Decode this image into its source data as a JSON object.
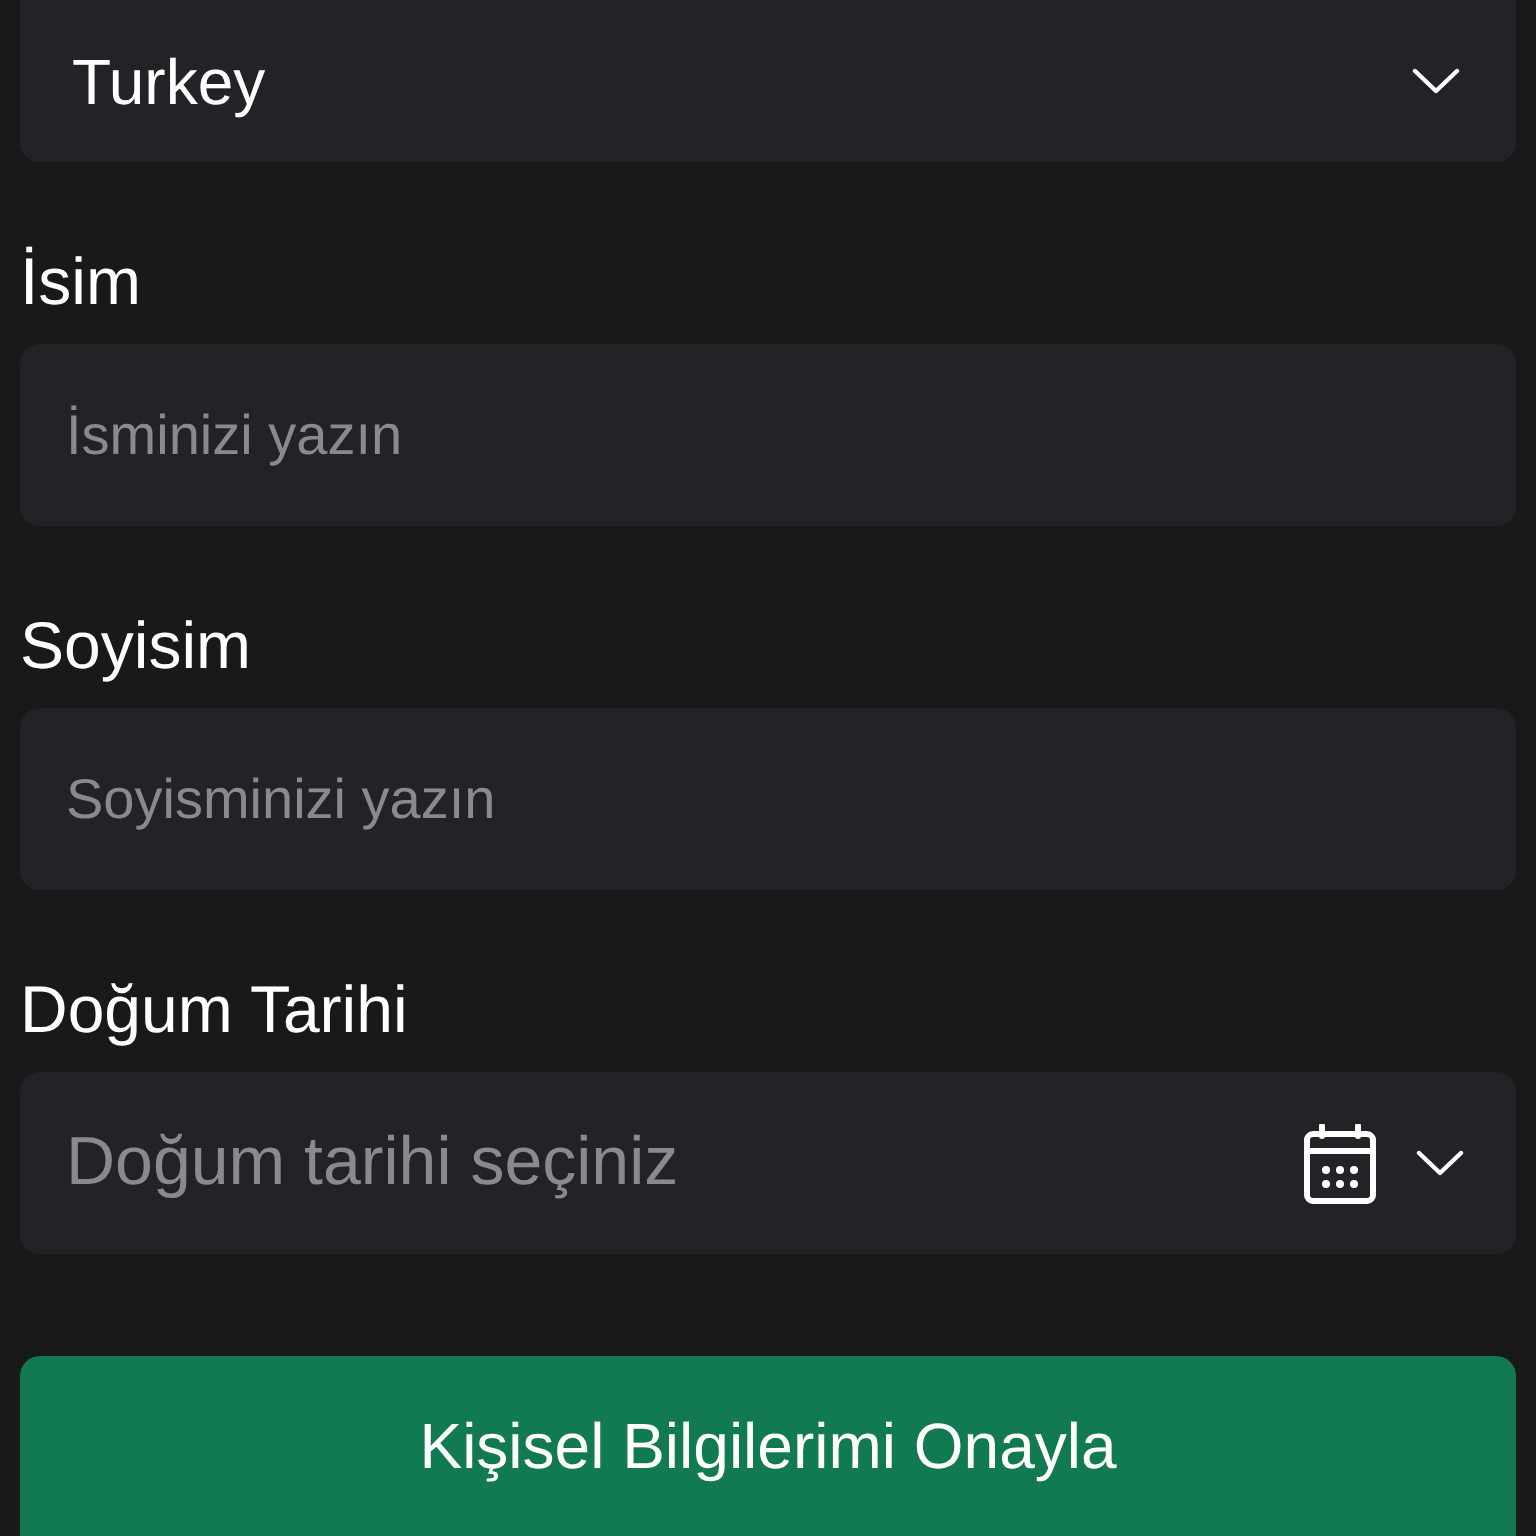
{
  "country_select": {
    "value": "Turkey"
  },
  "fields": [
    {
      "kind": "text",
      "label": "İsim",
      "placeholder": "İsminizi yazın"
    },
    {
      "kind": "text",
      "label": "Soyisim",
      "placeholder": "Soyisminizi yazın"
    },
    {
      "kind": "date",
      "label": "Doğum Tarihi",
      "placeholder": "Doğum tarihi seçiniz"
    }
  ],
  "submit_button": {
    "label": "Kişisel Bilgilerimi Onayla"
  }
}
